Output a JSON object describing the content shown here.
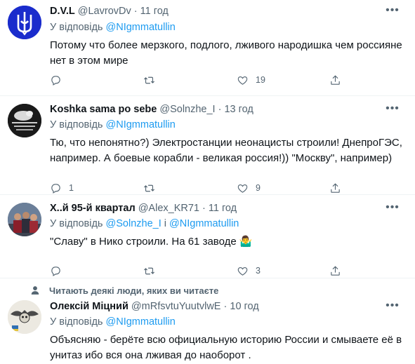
{
  "tweets": [
    {
      "name": "D.V.L",
      "handle": "@LavrovDv",
      "time": "11 год",
      "reply_prefix": "У відповідь",
      "reply_mentions": [
        "@NIgmmatullin"
      ],
      "reply_joiner": "",
      "text": "Потому что более мерзкого, подлого, лживого народишка чем россияне нет в этом мире",
      "replies": "",
      "retweets": "",
      "likes": "19",
      "avatar": "trident-avatar"
    },
    {
      "name": "Koshka sama po sebe",
      "handle": "@Solnzhe_I",
      "time": "13 год",
      "reply_prefix": "У відповідь",
      "reply_mentions": [
        "@NIgmmatullin"
      ],
      "reply_joiner": "",
      "text": "Тю, что непонятно?) Электростанции неонацисты строили! ДнепроГЭС, например. А боевые корабли - великая россия!)) \"Москву\", например)",
      "replies": "1",
      "retweets": "",
      "likes": "9",
      "avatar": "dog-photo-avatar"
    },
    {
      "name": "Х..й 95-й квартал",
      "handle": "@Alex_KR71",
      "time": "11 год",
      "reply_prefix": "У відповідь",
      "reply_mentions": [
        "@Solnzhe_I",
        "@NIgmmatullin"
      ],
      "reply_joiner": "і",
      "text": "\"Славу\" в Нико строили. На 61 заводе 🤷‍♂️",
      "replies": "",
      "retweets": "",
      "likes": "3",
      "avatar": "group-photo-avatar"
    },
    {
      "name": "Олексій Міцний",
      "handle": "@mRfsvtuYuutvlwE",
      "time": "10 год",
      "reply_prefix": "У відповідь",
      "reply_mentions": [
        "@NIgmmatullin"
      ],
      "reply_joiner": "",
      "text": "Объясняю - берёте всю официальную историю России и смываете её в унитаз ибо вся она лживая до наоборот .",
      "replies": "",
      "retweets": "",
      "likes": "",
      "avatar": "skull-emblem-avatar"
    }
  ],
  "social_context": "Читають деякі люди, яких ви читаєте",
  "colors": {
    "link": "#1d9bf0",
    "secondary": "#536471",
    "text": "#0f1419",
    "divider": "#eff3f4"
  },
  "icons": [
    "reply-icon",
    "retweet-icon",
    "like-icon",
    "share-icon",
    "more-icon",
    "person-icon"
  ]
}
